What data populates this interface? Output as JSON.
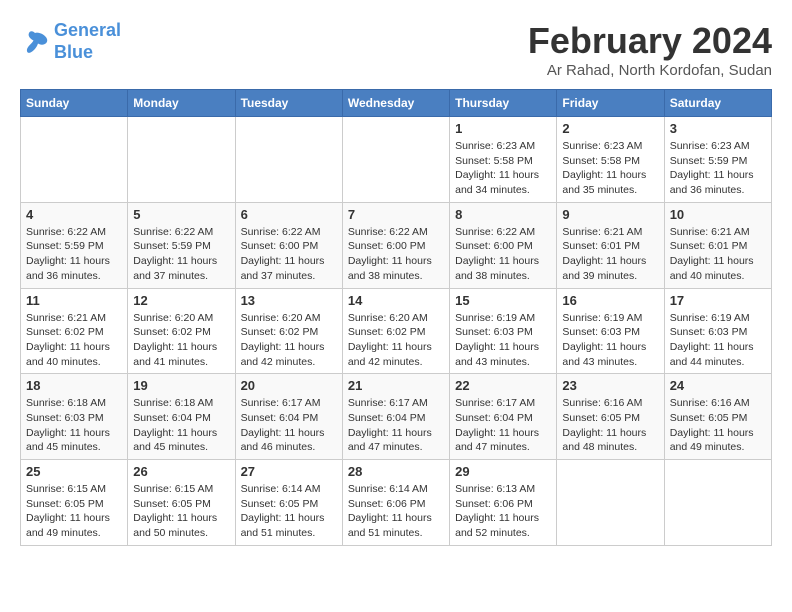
{
  "logo": {
    "line1": "General",
    "line2": "Blue"
  },
  "title": "February 2024",
  "subtitle": "Ar Rahad, North Kordofan, Sudan",
  "days_header": [
    "Sunday",
    "Monday",
    "Tuesday",
    "Wednesday",
    "Thursday",
    "Friday",
    "Saturday"
  ],
  "weeks": [
    [
      {
        "num": "",
        "info": ""
      },
      {
        "num": "",
        "info": ""
      },
      {
        "num": "",
        "info": ""
      },
      {
        "num": "",
        "info": ""
      },
      {
        "num": "1",
        "info": "Sunrise: 6:23 AM\nSunset: 5:58 PM\nDaylight: 11 hours and 34 minutes."
      },
      {
        "num": "2",
        "info": "Sunrise: 6:23 AM\nSunset: 5:58 PM\nDaylight: 11 hours and 35 minutes."
      },
      {
        "num": "3",
        "info": "Sunrise: 6:23 AM\nSunset: 5:59 PM\nDaylight: 11 hours and 36 minutes."
      }
    ],
    [
      {
        "num": "4",
        "info": "Sunrise: 6:22 AM\nSunset: 5:59 PM\nDaylight: 11 hours and 36 minutes."
      },
      {
        "num": "5",
        "info": "Sunrise: 6:22 AM\nSunset: 5:59 PM\nDaylight: 11 hours and 37 minutes."
      },
      {
        "num": "6",
        "info": "Sunrise: 6:22 AM\nSunset: 6:00 PM\nDaylight: 11 hours and 37 minutes."
      },
      {
        "num": "7",
        "info": "Sunrise: 6:22 AM\nSunset: 6:00 PM\nDaylight: 11 hours and 38 minutes."
      },
      {
        "num": "8",
        "info": "Sunrise: 6:22 AM\nSunset: 6:00 PM\nDaylight: 11 hours and 38 minutes."
      },
      {
        "num": "9",
        "info": "Sunrise: 6:21 AM\nSunset: 6:01 PM\nDaylight: 11 hours and 39 minutes."
      },
      {
        "num": "10",
        "info": "Sunrise: 6:21 AM\nSunset: 6:01 PM\nDaylight: 11 hours and 40 minutes."
      }
    ],
    [
      {
        "num": "11",
        "info": "Sunrise: 6:21 AM\nSunset: 6:02 PM\nDaylight: 11 hours and 40 minutes."
      },
      {
        "num": "12",
        "info": "Sunrise: 6:20 AM\nSunset: 6:02 PM\nDaylight: 11 hours and 41 minutes."
      },
      {
        "num": "13",
        "info": "Sunrise: 6:20 AM\nSunset: 6:02 PM\nDaylight: 11 hours and 42 minutes."
      },
      {
        "num": "14",
        "info": "Sunrise: 6:20 AM\nSunset: 6:02 PM\nDaylight: 11 hours and 42 minutes."
      },
      {
        "num": "15",
        "info": "Sunrise: 6:19 AM\nSunset: 6:03 PM\nDaylight: 11 hours and 43 minutes."
      },
      {
        "num": "16",
        "info": "Sunrise: 6:19 AM\nSunset: 6:03 PM\nDaylight: 11 hours and 43 minutes."
      },
      {
        "num": "17",
        "info": "Sunrise: 6:19 AM\nSunset: 6:03 PM\nDaylight: 11 hours and 44 minutes."
      }
    ],
    [
      {
        "num": "18",
        "info": "Sunrise: 6:18 AM\nSunset: 6:03 PM\nDaylight: 11 hours and 45 minutes."
      },
      {
        "num": "19",
        "info": "Sunrise: 6:18 AM\nSunset: 6:04 PM\nDaylight: 11 hours and 45 minutes."
      },
      {
        "num": "20",
        "info": "Sunrise: 6:17 AM\nSunset: 6:04 PM\nDaylight: 11 hours and 46 minutes."
      },
      {
        "num": "21",
        "info": "Sunrise: 6:17 AM\nSunset: 6:04 PM\nDaylight: 11 hours and 47 minutes."
      },
      {
        "num": "22",
        "info": "Sunrise: 6:17 AM\nSunset: 6:04 PM\nDaylight: 11 hours and 47 minutes."
      },
      {
        "num": "23",
        "info": "Sunrise: 6:16 AM\nSunset: 6:05 PM\nDaylight: 11 hours and 48 minutes."
      },
      {
        "num": "24",
        "info": "Sunrise: 6:16 AM\nSunset: 6:05 PM\nDaylight: 11 hours and 49 minutes."
      }
    ],
    [
      {
        "num": "25",
        "info": "Sunrise: 6:15 AM\nSunset: 6:05 PM\nDaylight: 11 hours and 49 minutes."
      },
      {
        "num": "26",
        "info": "Sunrise: 6:15 AM\nSunset: 6:05 PM\nDaylight: 11 hours and 50 minutes."
      },
      {
        "num": "27",
        "info": "Sunrise: 6:14 AM\nSunset: 6:05 PM\nDaylight: 11 hours and 51 minutes."
      },
      {
        "num": "28",
        "info": "Sunrise: 6:14 AM\nSunset: 6:06 PM\nDaylight: 11 hours and 51 minutes."
      },
      {
        "num": "29",
        "info": "Sunrise: 6:13 AM\nSunset: 6:06 PM\nDaylight: 11 hours and 52 minutes."
      },
      {
        "num": "",
        "info": ""
      },
      {
        "num": "",
        "info": ""
      }
    ]
  ]
}
